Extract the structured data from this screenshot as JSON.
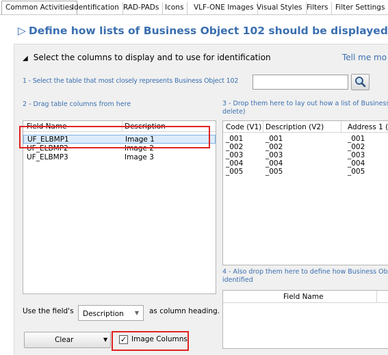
{
  "tabs": [
    "Common Activities",
    "Identification",
    "RAD-PADs",
    "Icons",
    "VLF-ONE Images",
    "Visual Styles",
    "Filters",
    "Filter Settings"
  ],
  "title": "Define how lists of Business Object 102 should be displayed",
  "title_icon": "triangle-right-icon",
  "section": {
    "label": "Select the columns to display and to use for identification",
    "help_link": "Tell me mo"
  },
  "step1": {
    "label": "1 - Select the table that most closely represents Business Object 102",
    "input_value": ""
  },
  "step2": {
    "label": "2 - Drag table columns from here"
  },
  "step3": {
    "label": "3 - Drop them here to lay out how a list of Business delete)"
  },
  "step4": {
    "label": "4 - Also drop them here to define how Business Ob identified"
  },
  "left_list": {
    "columns": [
      "Field Name",
      "Description"
    ],
    "rows": [
      [
        "UF_ELBMP1",
        "Image 1"
      ],
      [
        "UF_ELBMP2",
        "Image 2"
      ],
      [
        "UF_ELBMP3",
        "Image 3"
      ]
    ]
  },
  "right_table": {
    "columns": [
      "Code (V1)",
      "Description (V2)",
      "Address 1 (A"
    ],
    "rows": [
      [
        "_001",
        "_001",
        "_001"
      ],
      [
        "_002",
        "_002",
        "_002"
      ],
      [
        "_003",
        "_003",
        "_003"
      ],
      [
        "_004",
        "_004",
        "_004"
      ],
      [
        "_005",
        "_005",
        "_005"
      ]
    ]
  },
  "bottom_table": {
    "column": "Field Name"
  },
  "heading": {
    "prefix": "Use the field's",
    "value": "Description",
    "suffix": "as column heading."
  },
  "clear_label": "Clear",
  "image_columns": {
    "label": "Image Columns",
    "checked_mark": "✓"
  },
  "colors": {
    "link": "#3a6fb0",
    "highlight": "#e0221f"
  }
}
